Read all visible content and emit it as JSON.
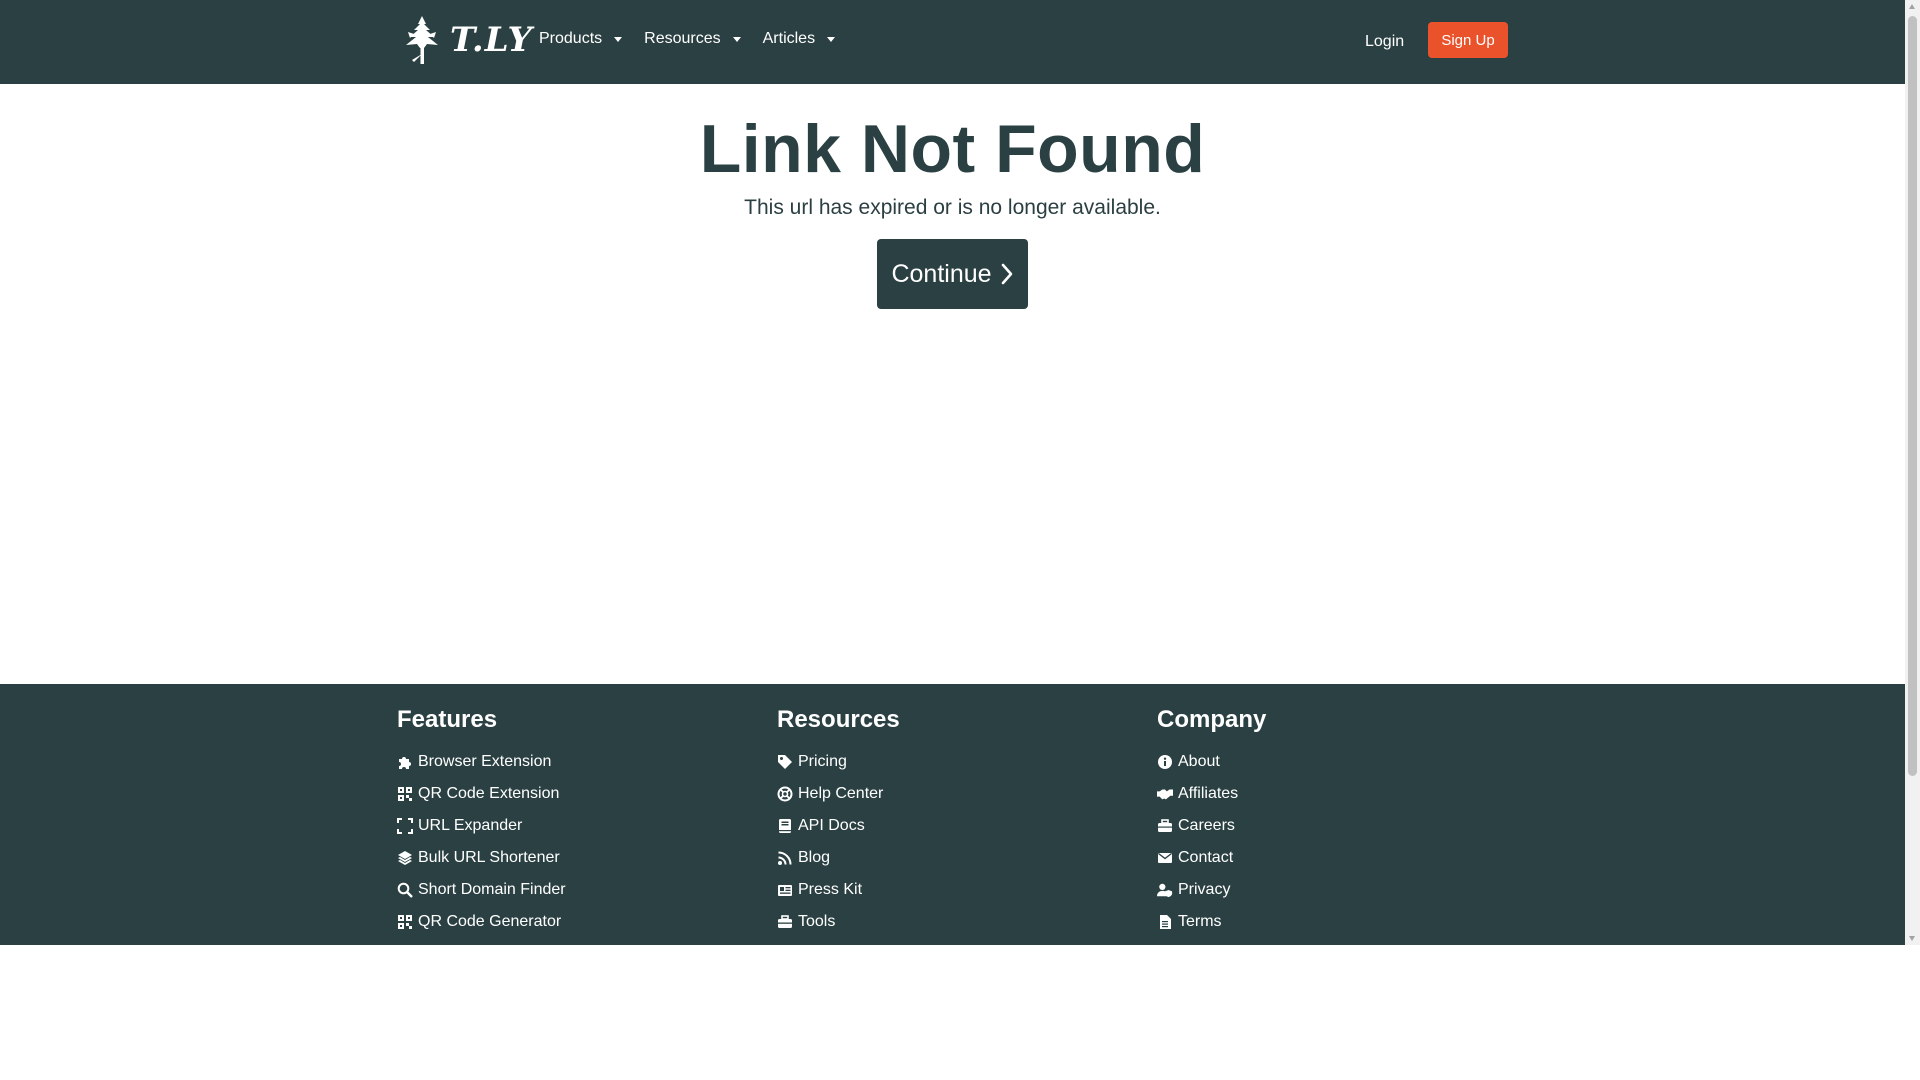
{
  "brand": {
    "name": "T.LY",
    "logo_icon": "tree-logo-icon"
  },
  "nav": {
    "items": [
      {
        "label": "Products",
        "icon": "caret-down-icon"
      },
      {
        "label": "Resources",
        "icon": "caret-down-icon"
      },
      {
        "label": "Articles",
        "icon": "caret-down-icon"
      }
    ],
    "login_label": "Login",
    "signup_label": "Sign Up"
  },
  "main": {
    "title": "Link Not Found",
    "subtitle": "This url has expired or is no longer available.",
    "continue_label": "Continue",
    "continue_icon": "chevron-right-icon"
  },
  "footer": {
    "features": {
      "heading": "Features",
      "items": [
        {
          "label": "Browser Extension",
          "icon": "puzzle-icon"
        },
        {
          "label": "QR Code Extension",
          "icon": "qrcode-icon"
        },
        {
          "label": "URL Expander",
          "icon": "expand-icon"
        },
        {
          "label": "Bulk URL Shortener",
          "icon": "layers-icon"
        },
        {
          "label": "Short Domain Finder",
          "icon": "search-icon"
        },
        {
          "label": "QR Code Generator",
          "icon": "qrcode-icon"
        }
      ]
    },
    "resources": {
      "heading": "Resources",
      "items": [
        {
          "label": "Pricing",
          "icon": "tag-icon"
        },
        {
          "label": "Help Center",
          "icon": "lifebuoy-icon"
        },
        {
          "label": "API Docs",
          "icon": "book-icon"
        },
        {
          "label": "Blog",
          "icon": "rss-icon"
        },
        {
          "label": "Press Kit",
          "icon": "newspaper-icon"
        },
        {
          "label": "Tools",
          "icon": "toolbox-icon"
        }
      ]
    },
    "company": {
      "heading": "Company",
      "items": [
        {
          "label": "About",
          "icon": "info-icon"
        },
        {
          "label": "Affiliates",
          "icon": "handshake-icon"
        },
        {
          "label": "Careers",
          "icon": "briefcase-icon"
        },
        {
          "label": "Contact",
          "icon": "envelope-icon"
        },
        {
          "label": "Privacy",
          "icon": "user-shield-icon"
        },
        {
          "label": "Terms",
          "icon": "file-icon"
        }
      ]
    }
  },
  "colors": {
    "navbar_bg": "#2b4042",
    "accent": "#e9522b",
    "text_dark": "#2b4042",
    "white": "#ffffff"
  }
}
